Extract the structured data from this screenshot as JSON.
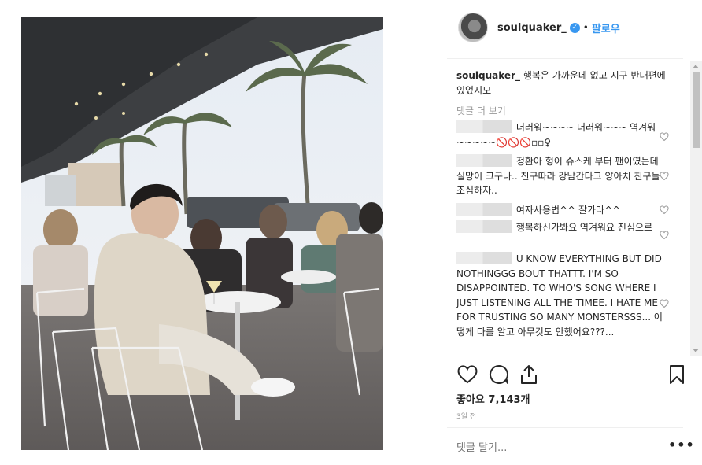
{
  "post": {
    "username": "soulquaker_",
    "verified_icon": "verified-badge-icon",
    "separator": "•",
    "follow_label": "팔로우",
    "caption_user": "soulquaker_",
    "caption_text": "행복은 가까운데 없고 지구 반대편에 있었지모",
    "view_more": "댓글 더 보기"
  },
  "comments": [
    {
      "text": "더러워~~~~ 더러워~~~ 역겨워~~~~~🚫🚫🚫▫▫♀"
    },
    {
      "text": "정환아 형이 슈스케 부터 팬이였는데 실망이 크구나.. 친구따라 강남간다고 양아치 친구들 조심하자.."
    },
    {
      "text": "여자사용법^^ 잘가라^^"
    },
    {
      "text": "행복하신가봐요 역겨워요 진심으로"
    },
    {
      "text": "U KNOW EVERYTHING BUT DID NOTHINGGG BOUT THATTT. I'M SO DISAPPOINTED. TO WHO'S SONG WHERE I JUST LISTENING ALL THE TIMEE. I HATE ME FOR TRUSTING SO MANY MONSTERSSS... 어떻게 다를 알고 아무것도 안했어요???..."
    }
  ],
  "stats": {
    "likes_label": "좋아요",
    "likes_count": "7,143개",
    "time_ago": "3일 전"
  },
  "composer": {
    "placeholder": "댓글 달기...",
    "more_label": "•••"
  },
  "icons": {
    "like": "heart-icon",
    "comment": "comment-bubble-icon",
    "share": "share-icon",
    "save": "bookmark-icon"
  }
}
